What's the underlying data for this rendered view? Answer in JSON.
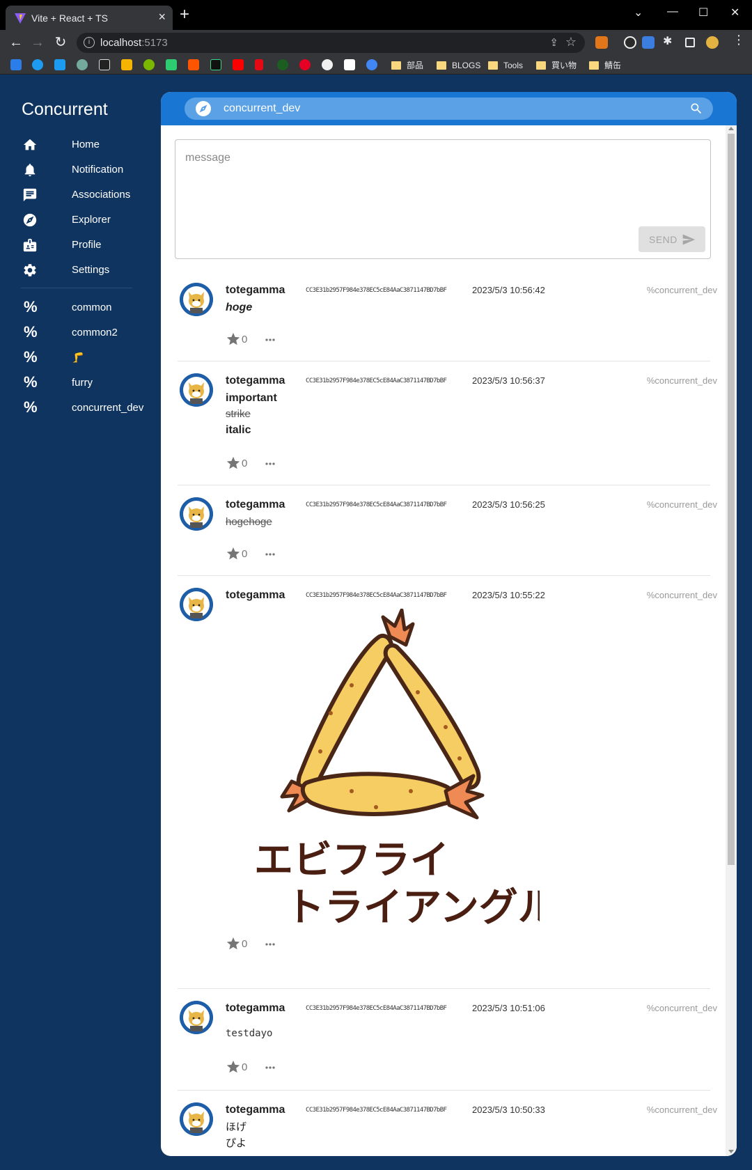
{
  "browser": {
    "tab_title": "Vite + React + TS",
    "url_host": "localhost",
    "url_port": ":5173",
    "bookmark_folders": [
      "部品",
      "BLOGS",
      "Tools",
      "買い物",
      "鯖缶"
    ]
  },
  "app": {
    "title": "Concurrent",
    "nav": [
      "Home",
      "Notification",
      "Associations",
      "Explorer",
      "Profile",
      "Settings"
    ],
    "streams": [
      "common",
      "common2",
      "🦵",
      "furry",
      "concurrent_dev"
    ]
  },
  "search": {
    "value": "concurrent_dev"
  },
  "composer": {
    "placeholder": "message",
    "send_label": "SEND"
  },
  "messages": [
    {
      "author": "totegamma",
      "address": "CC3E31b2957F984e378EC5cE84AaC3871147BD7bBF",
      "time": "2023/5/3 10:56:42",
      "stream": "%concurrent_dev",
      "lines": [
        "hoge"
      ],
      "likes": "0"
    },
    {
      "author": "totegamma",
      "address": "CC3E31b2957F984e378EC5cE84AaC3871147BD7bBF",
      "time": "2023/5/3 10:56:37",
      "stream": "%concurrent_dev",
      "lines": [
        "important",
        "strike",
        "italic"
      ],
      "likes": "0"
    },
    {
      "author": "totegamma",
      "address": "CC3E31b2957F984e378EC5cE84AaC3871147BD7bBF",
      "time": "2023/5/3 10:56:25",
      "stream": "%concurrent_dev",
      "lines": [
        "hogehoge"
      ],
      "likes": "0"
    },
    {
      "author": "totegamma",
      "address": "CC3E31b2957F984e378EC5cE84AaC3871147BD7bBF",
      "time": "2023/5/3 10:55:22",
      "stream": "%concurrent_dev",
      "image_text": [
        "エビフライ",
        "トライアングル"
      ],
      "likes": "0"
    },
    {
      "author": "totegamma",
      "address": "CC3E31b2957F984e378EC5cE84AaC3871147BD7bBF",
      "time": "2023/5/3 10:51:06",
      "stream": "%concurrent_dev",
      "lines": [
        "testdayo"
      ],
      "likes": "0"
    },
    {
      "author": "totegamma",
      "address": "CC3E31b2957F984e378EC5cE84AaC3871147BD7bBF",
      "time": "2023/5/3 10:50:33",
      "stream": "%concurrent_dev",
      "lines": [
        "ほげ",
        "ぴよ"
      ]
    }
  ],
  "colors": {
    "sidebar_bg": "#0f3460",
    "header_blue": "#1976d2",
    "search_bg": "#5aa1e6"
  }
}
